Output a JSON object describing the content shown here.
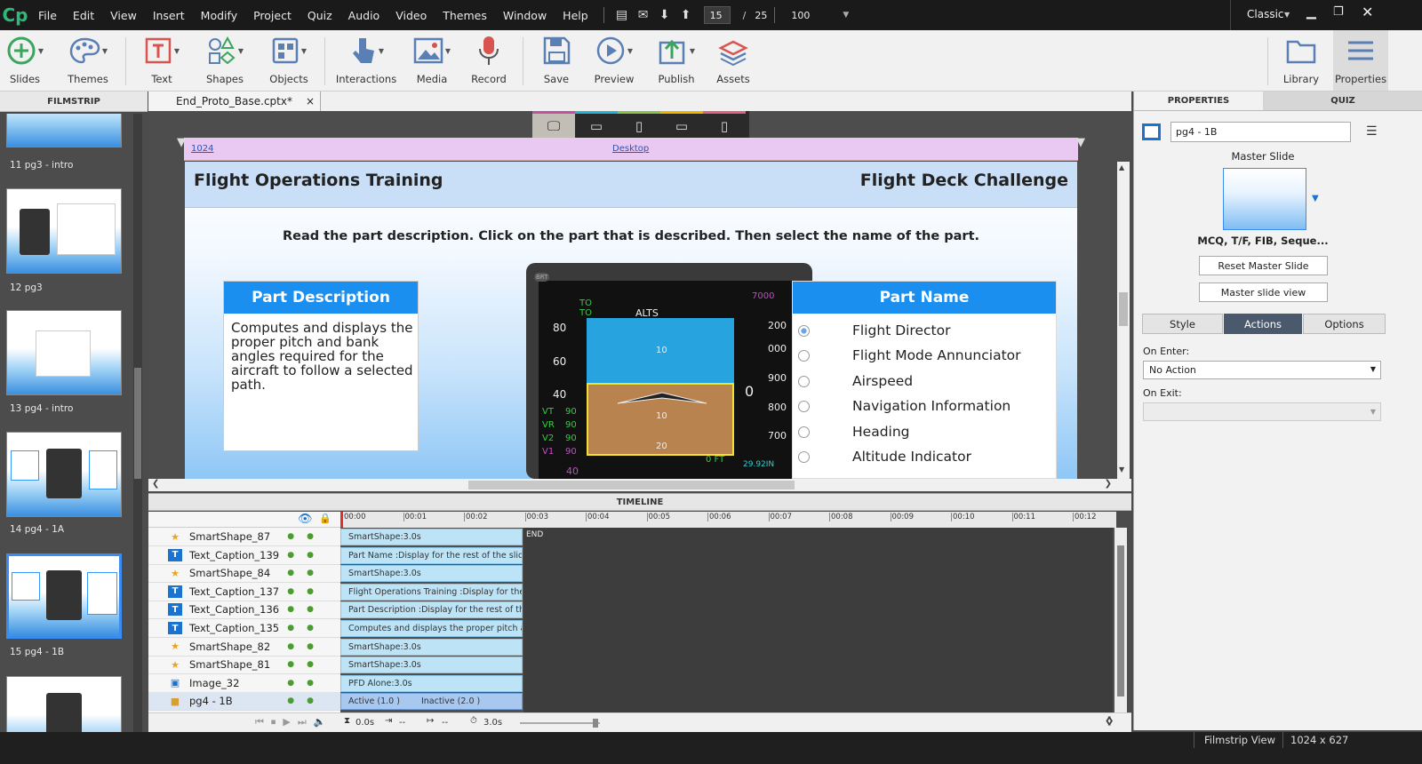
{
  "menubar": {
    "logo": "Cp",
    "items": [
      "File",
      "Edit",
      "View",
      "Insert",
      "Modify",
      "Project",
      "Quiz",
      "Audio",
      "Video",
      "Themes",
      "Window",
      "Help"
    ],
    "current_slide": "15",
    "slide_separator": "/",
    "total_slides": "25",
    "zoom": "100",
    "workspace": "Classic"
  },
  "toolbar": {
    "slides": "Slides",
    "themes": "Themes",
    "text": "Text",
    "shapes": "Shapes",
    "objects": "Objects",
    "interactions": "Interactions",
    "media": "Media",
    "record": "Record",
    "save": "Save",
    "preview": "Preview",
    "publish": "Publish",
    "assets": "Assets",
    "library": "Library",
    "properties": "Properties"
  },
  "filmstrip": {
    "title": "FILMSTRIP",
    "slides": [
      {
        "label": "11 pg3 - intro"
      },
      {
        "label": "12 pg3"
      },
      {
        "label": "13 pg4 - intro"
      },
      {
        "label": "14 pg4 - 1A"
      },
      {
        "label": "15 pg4 - 1B"
      }
    ]
  },
  "doc": {
    "tab": "End_Proto_Base.cptx*",
    "close": "×"
  },
  "stage": {
    "ruler_width": "1024",
    "device": "Desktop",
    "slide": {
      "left_title": "Flight Operations Training",
      "right_title": "Flight Deck Challenge",
      "instruction": "Read the part description. Click on the part that is described. Then select the name of the part.",
      "desc_title": "Part Description",
      "desc_text": "Computes and displays the proper pitch and bank angles required for the aircraft to follow a selected path.",
      "name_title": "Part Name",
      "options": [
        "Flight Director",
        "Flight Mode Annunciator",
        "Airspeed",
        "Navigation Information",
        "Heading",
        "Altitude Indicator"
      ],
      "selected_option": 0,
      "pfd": {
        "tag": "BRT",
        "alts": "ALTS",
        "speeds": [
          "80",
          "60",
          "40"
        ],
        "pitch": [
          "10",
          "10",
          "20"
        ],
        "vt": [
          "VT",
          "VR",
          "V2",
          "V1"
        ],
        "vvals": [
          "90",
          "90",
          "90",
          "90"
        ],
        "alt_scale": [
          "200",
          "000",
          "900",
          "800",
          "700"
        ],
        "mode": "7000",
        "baro": "29.92IN",
        "bottom": "0 FT",
        "altbox": "0",
        "airspeed_top": [
          "TO",
          "TO"
        ],
        "speed_bottom": "40"
      }
    }
  },
  "timeline": {
    "title": "TIMELINE",
    "ticks": [
      "00:00",
      "00:01",
      "00:02",
      "00:03",
      "00:04",
      "00:05",
      "00:06",
      "00:07",
      "00:08",
      "00:09",
      "00:10",
      "00:11",
      "00:12"
    ],
    "end": "END",
    "rows": [
      {
        "name": "SmartShape_87",
        "bar": "SmartShape:3.0s",
        "type": "star"
      },
      {
        "name": "Text_Caption_139",
        "bar": "Part Name :Display for the rest of the slide",
        "type": "text"
      },
      {
        "name": "SmartShape_84",
        "bar": "SmartShape:3.0s",
        "type": "star"
      },
      {
        "name": "Text_Caption_137",
        "bar": "Flight Operations Training :Display for the r...",
        "type": "text"
      },
      {
        "name": "Text_Caption_136",
        "bar": "Part Description :Display for the rest of the s...",
        "type": "text"
      },
      {
        "name": "Text_Caption_135",
        "bar": "Computes and displays the proper pitch and...",
        "type": "text"
      },
      {
        "name": "SmartShape_82",
        "bar": "SmartShape:3.0s",
        "type": "star"
      },
      {
        "name": "SmartShape_81",
        "bar": "SmartShape:3.0s",
        "type": "star"
      },
      {
        "name": "Image_32",
        "bar": "PFD Alone:3.0s",
        "type": "image"
      },
      {
        "name": "pg4 - 1B",
        "bar": "Active (1.0 )",
        "bar2": "Inactive (2.0 )",
        "type": "slide"
      }
    ],
    "controls": {
      "start": "0.0s",
      "t1": "--",
      "t2": "--",
      "duration": "3.0s"
    }
  },
  "properties": {
    "tab_properties": "PROPERTIES",
    "tab_quiz": "QUIZ",
    "slide_name": "pg4 - 1B",
    "master_slide_label": "Master Slide",
    "master_name": "MCQ, T/F, FIB, Seque...",
    "reset_master": "Reset Master Slide",
    "master_view": "Master slide view",
    "tabs": [
      "Style",
      "Actions",
      "Options"
    ],
    "on_enter_label": "On Enter:",
    "on_enter_value": "No Action",
    "on_exit_label": "On Exit:"
  },
  "status": {
    "view": "Filmstrip View",
    "dims": "1024 x 627"
  },
  "colors": {
    "accent": "#1a8ff0",
    "logo": "#2fb878",
    "selection": "#3b8cf0"
  }
}
